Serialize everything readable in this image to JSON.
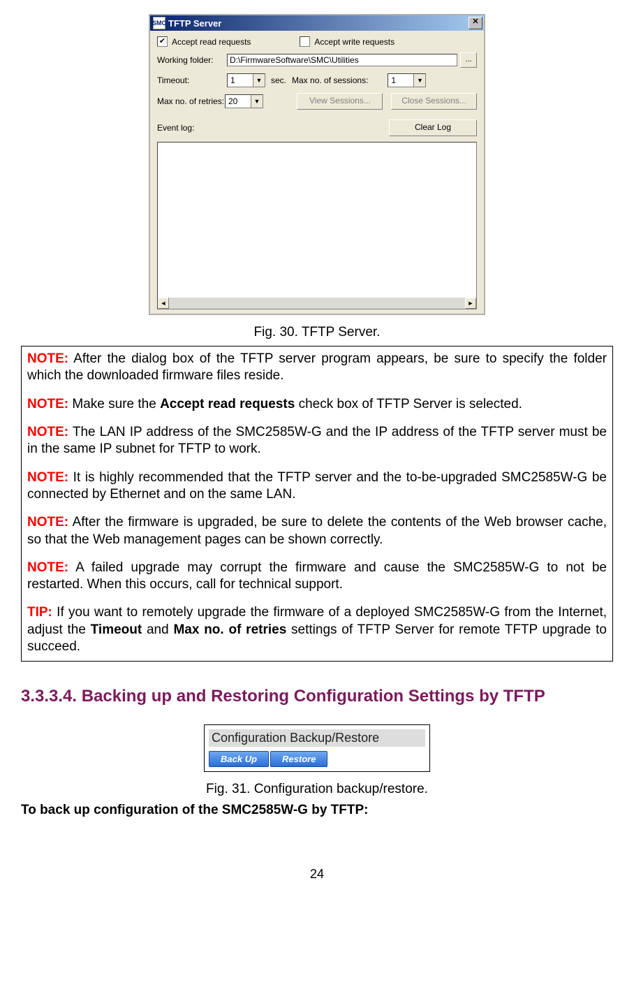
{
  "dialog": {
    "title": "TFTP Server",
    "icon_text": "SMC",
    "close_glyph": "✕",
    "accept_read_label": "Accept read requests",
    "accept_read_checked": "✔",
    "accept_write_label": "Accept write requests",
    "working_folder_label": "Working folder:",
    "working_folder_value": "D:\\FirmwareSoftware\\SMC\\Utilities",
    "browse_label": "...",
    "timeout_label": "Timeout:",
    "timeout_value": "1",
    "sec_label": "sec.",
    "max_sessions_label": "Max no. of sessions:",
    "max_sessions_value": "1",
    "max_retries_label": "Max no. of retries:",
    "max_retries_value": "20",
    "view_sessions": "View Sessions...",
    "close_sessions": "Close Sessions...",
    "event_log_label": "Event log:",
    "clear_log": "Clear Log",
    "arrow_down": "▼",
    "scroll_left": "◄",
    "scroll_right": "►"
  },
  "fig30": "Fig. 30. TFTP Server.",
  "notes": {
    "note_label": "NOTE:",
    "tip_label": "TIP:",
    "n1": " After the dialog box of the TFTP server program appears, be sure to specify the folder which the downloaded firmware files reside.",
    "n2a": " Make sure the ",
    "n2b": "Accept read requests",
    "n2c": " check box of TFTP Server is selected.",
    "n3": " The LAN IP address of the SMC2585W-G and the IP address of the TFTP server must be in the same IP subnet for TFTP to work.",
    "n4": " It is highly recommended that the TFTP server and the to-be-upgraded SMC2585W-G be connected by Ethernet and on the same LAN.",
    "n5": " After the firmware is upgraded, be sure to delete the contents of the Web browser cache, so that the Web management pages can be shown correctly.",
    "n6": " A failed upgrade may corrupt the firmware and cause the SMC2585W-G to not be restarted. When this occurs, call for technical support.",
    "t1a": " If you want to remotely upgrade the firmware of a deployed SMC2585W-G from the Internet, adjust the ",
    "t1b": "Timeout",
    "t1c": " and ",
    "t1d": "Max no. of retries",
    "t1e": " settings of TFTP Server for remote TFTP upgrade to succeed."
  },
  "section_heading": "3.3.3.4. Backing up and Restoring Configuration Settings by TFTP",
  "backup": {
    "title": "Configuration Backup/Restore",
    "backup_btn": "Back Up",
    "restore_btn": "Restore"
  },
  "fig31": "Fig. 31. Configuration backup/restore.",
  "body1": "To back up configuration of the SMC2585W-G by TFTP:",
  "page_number": "24"
}
